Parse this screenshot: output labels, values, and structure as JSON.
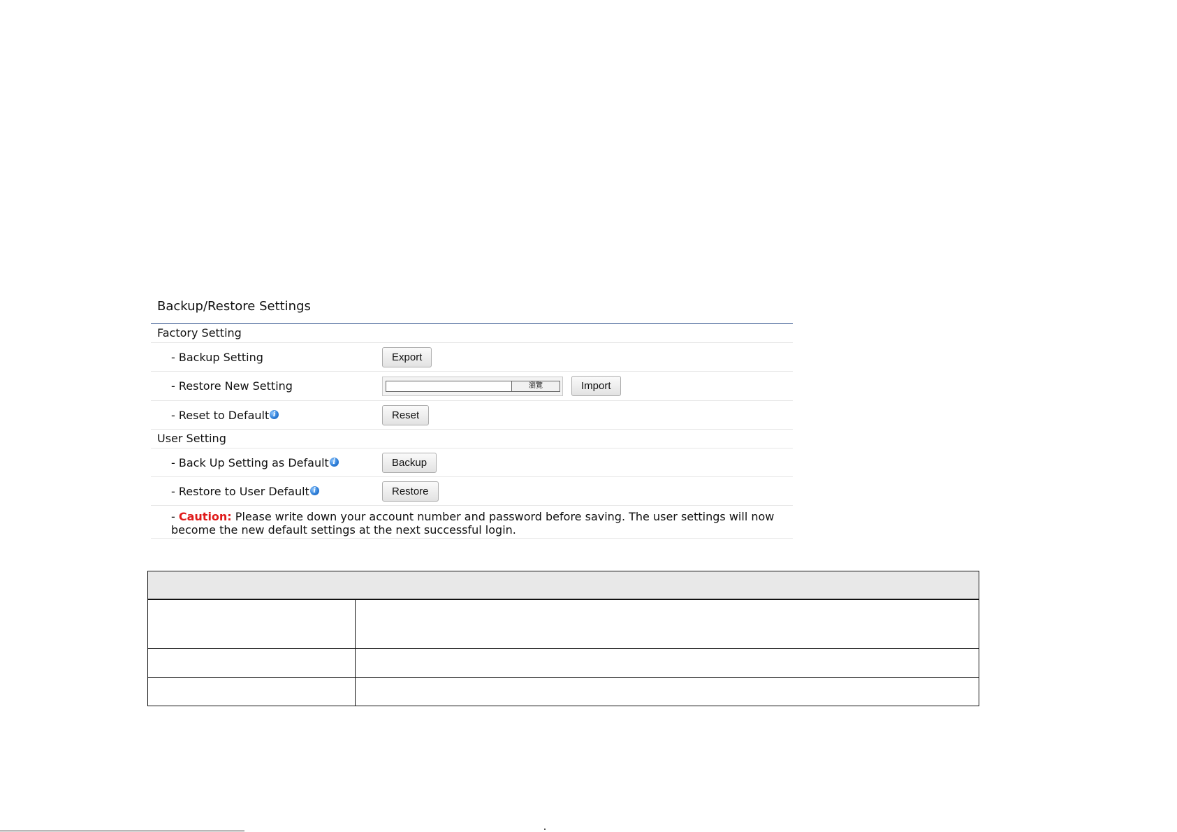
{
  "panel": {
    "title": "Backup/Restore Settings",
    "factory_section": {
      "heading": "Factory Setting",
      "rows": [
        {
          "label": "- Backup Setting",
          "button": "Export"
        },
        {
          "label": "- Restore New Setting",
          "file_browse_label": "瀏覽",
          "button": "Import"
        },
        {
          "label": "- Reset to Default",
          "has_info_icon": true,
          "button": "Reset"
        }
      ]
    },
    "user_section": {
      "heading": "User Setting",
      "rows": [
        {
          "label": "- Back Up Setting as Default",
          "has_info_icon": true,
          "button": "Backup"
        },
        {
          "label": "- Restore to User Default",
          "has_info_icon": true,
          "button": "Restore"
        }
      ]
    },
    "caution": {
      "prefix": "- ",
      "keyword": "Caution:",
      "text": " Please write down your account number and password before saving. The user settings will now become the new default settings at the next successful login."
    }
  },
  "icons": {
    "info": "info-icon"
  },
  "colors": {
    "title_rule": "#2c4e8a",
    "caution": "#e01b1b",
    "table_header_bg": "#e8e8e8"
  }
}
